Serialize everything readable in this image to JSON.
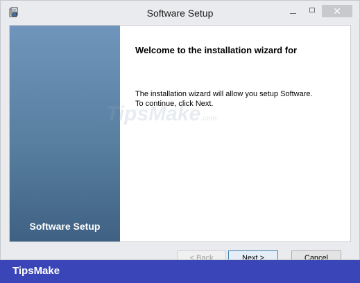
{
  "window": {
    "title": "Software Setup"
  },
  "titlebar": {
    "close_label": "✕"
  },
  "side_panel": {
    "title": "Software Setup"
  },
  "main": {
    "heading": "Welcome to the installation wizard for",
    "description_line1": "The installation wizard will allow you setup Software.",
    "description_line2": "To continue, click Next."
  },
  "watermark": {
    "brand": "TipsMake",
    "suffix": ".com"
  },
  "buttons": {
    "back": "< Back",
    "next": "Next >",
    "cancel": "Cancel"
  },
  "footer": {
    "brand": "TipsMake"
  },
  "colors": {
    "footer_bg": "#3a46b8",
    "side_panel_top": "#6f95bc",
    "side_panel_bottom": "#3f6184"
  }
}
